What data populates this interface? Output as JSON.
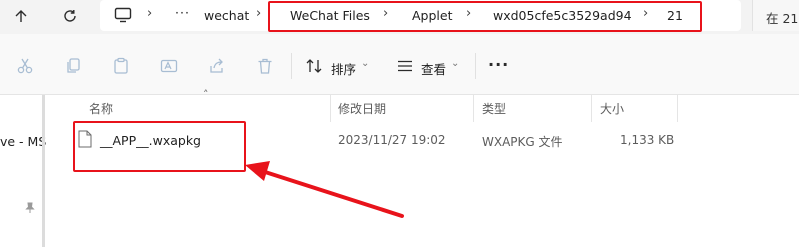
{
  "address": {
    "crumbs": [
      "wechat",
      "WeChat Files",
      "Applet",
      "wxd05cfe5c3529ad94",
      "21"
    ],
    "overflow": "···",
    "search_prefix": "在 21"
  },
  "toolbar": {
    "sort_label": "排序",
    "view_label": "查看",
    "more": "···"
  },
  "nav": {
    "pinned_label": "ve - MS"
  },
  "columns": [
    "名称",
    "修改日期",
    "类型",
    "大小"
  ],
  "files": [
    {
      "name": "__APP__.wxapkg",
      "modified": "2023/11/27 19:02",
      "type": "WXAPKG 文件",
      "size": "1,133 KB"
    }
  ],
  "annotation_color": "#e8131b"
}
